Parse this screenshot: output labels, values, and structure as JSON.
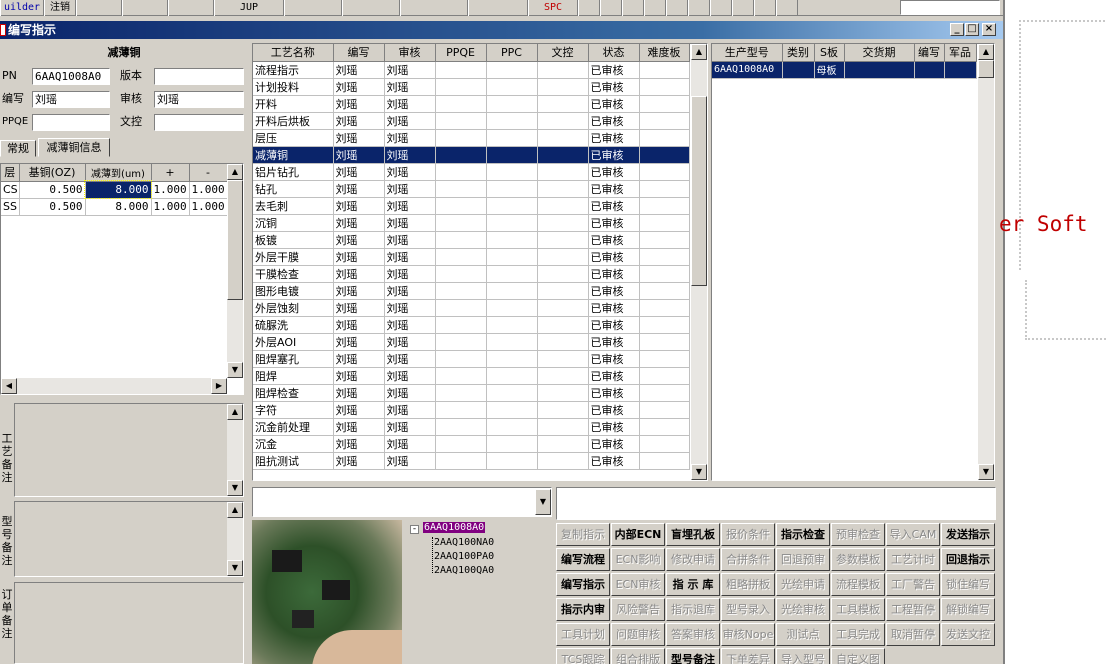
{
  "toolbar": {
    "items": [
      "uilder",
      "注销",
      "",
      "",
      "",
      "JUP",
      "",
      "",
      "",
      "",
      "SPC",
      "",
      "",
      "",
      "",
      "",
      "",
      "",
      "",
      "",
      ""
    ]
  },
  "window": {
    "title": "编写指示",
    "min": "_",
    "max": "□",
    "close": "×"
  },
  "left_panel": {
    "header": "减薄铜",
    "pn_label": "PN",
    "pn_value": "6AAQ1008A0",
    "version_label": "版本",
    "version_value": "",
    "writer_label": "编写",
    "writer_value": "刘瑶",
    "reviewer_label": "审核",
    "reviewer_value": "刘瑶",
    "ppqe_label": "PPQE",
    "ppqe_value": "",
    "doc_label": "文控",
    "doc_value": "",
    "tabs": [
      "常规",
      "减薄铜信息"
    ],
    "thin_table": {
      "headers": [
        "层",
        "基铜(OZ)",
        "减薄到(um)",
        "+",
        "-"
      ],
      "rows": [
        [
          "CS",
          "0.500",
          "8.000",
          "1.000",
          "1.000"
        ],
        [
          "SS",
          "0.500",
          "8.000",
          "1.000",
          "1.000"
        ]
      ]
    },
    "remarks": [
      {
        "label": "工艺备注"
      },
      {
        "label": "型号备注"
      },
      {
        "label": "订单备注"
      }
    ]
  },
  "process_table": {
    "headers": [
      "工艺名称",
      "编写",
      "审核",
      "PPQE",
      "PPC",
      "文控",
      "状态",
      "难度板"
    ],
    "rows": [
      [
        "流程指示",
        "刘瑶",
        "刘瑶",
        "",
        "",
        "",
        "已审核",
        ""
      ],
      [
        "计划投料",
        "刘瑶",
        "刘瑶",
        "",
        "",
        "",
        "已审核",
        ""
      ],
      [
        "开料",
        "刘瑶",
        "刘瑶",
        "",
        "",
        "",
        "已审核",
        ""
      ],
      [
        "开料后烘板",
        "刘瑶",
        "刘瑶",
        "",
        "",
        "",
        "已审核",
        ""
      ],
      [
        "层压",
        "刘瑶",
        "刘瑶",
        "",
        "",
        "",
        "已审核",
        ""
      ],
      [
        "减薄铜",
        "刘瑶",
        "刘瑶",
        "",
        "",
        "",
        "已审核",
        ""
      ],
      [
        "铝片钻孔",
        "刘瑶",
        "刘瑶",
        "",
        "",
        "",
        "已审核",
        ""
      ],
      [
        "钻孔",
        "刘瑶",
        "刘瑶",
        "",
        "",
        "",
        "已审核",
        ""
      ],
      [
        "去毛刺",
        "刘瑶",
        "刘瑶",
        "",
        "",
        "",
        "已审核",
        ""
      ],
      [
        "沉铜",
        "刘瑶",
        "刘瑶",
        "",
        "",
        "",
        "已审核",
        ""
      ],
      [
        "板镀",
        "刘瑶",
        "刘瑶",
        "",
        "",
        "",
        "已审核",
        ""
      ],
      [
        "外层干膜",
        "刘瑶",
        "刘瑶",
        "",
        "",
        "",
        "已审核",
        ""
      ],
      [
        "干膜检查",
        "刘瑶",
        "刘瑶",
        "",
        "",
        "",
        "已审核",
        ""
      ],
      [
        "图形电镀",
        "刘瑶",
        "刘瑶",
        "",
        "",
        "",
        "已审核",
        ""
      ],
      [
        "外层蚀刻",
        "刘瑶",
        "刘瑶",
        "",
        "",
        "",
        "已审核",
        ""
      ],
      [
        "硫脲洗",
        "刘瑶",
        "刘瑶",
        "",
        "",
        "",
        "已审核",
        ""
      ],
      [
        "外层AOI",
        "刘瑶",
        "刘瑶",
        "",
        "",
        "",
        "已审核",
        ""
      ],
      [
        "阻焊塞孔",
        "刘瑶",
        "刘瑶",
        "",
        "",
        "",
        "已审核",
        ""
      ],
      [
        "阻焊",
        "刘瑶",
        "刘瑶",
        "",
        "",
        "",
        "已审核",
        ""
      ],
      [
        "阻焊检查",
        "刘瑶",
        "刘瑶",
        "",
        "",
        "",
        "已审核",
        ""
      ],
      [
        "字符",
        "刘瑶",
        "刘瑶",
        "",
        "",
        "",
        "已审核",
        ""
      ],
      [
        "沉金前处理",
        "刘瑶",
        "刘瑶",
        "",
        "",
        "",
        "已审核",
        ""
      ],
      [
        "沉金",
        "刘瑶",
        "刘瑶",
        "",
        "",
        "",
        "已审核",
        ""
      ],
      [
        "阻抗测试",
        "刘瑶",
        "刘瑶",
        "",
        "",
        "",
        "已审核",
        ""
      ]
    ],
    "selected_row": 5
  },
  "model_table": {
    "headers": [
      "生产型号",
      "类别",
      "S板",
      "交货期",
      "编写",
      "军品"
    ],
    "rows": [
      [
        "6AAQ1008A0",
        "",
        "母板",
        "",
        "",
        ""
      ]
    ]
  },
  "tree": {
    "root": "6AAQ1008A0",
    "children": [
      "2AAQ100NA0",
      "2AAQ100PA0",
      "2AAQ100QA0"
    ]
  },
  "buttons": [
    [
      "复制指示",
      "内部ECN",
      "盲埋孔板",
      "报价条件",
      "指示检查",
      "预审检查",
      "导入CAM",
      "发送指示"
    ],
    [
      "编写流程",
      "ECN影响",
      "修改申请",
      "合拼条件",
      "回退预审",
      "参数模板",
      "工艺计时",
      "回退指示"
    ],
    [
      "编写指示",
      "ECN审核",
      "指 示 库",
      "粗略拼板",
      "光绘申请",
      "流程模板",
      "工厂警告",
      "锁住编写"
    ],
    [
      "指示内审",
      "风险警告",
      "指示退库",
      "型号录入",
      "光绘审核",
      "工具模板",
      "工程暂停",
      "解锁编写"
    ],
    [
      "工具计划",
      "问题审核",
      "答案审核",
      "审核Nope",
      "测试点",
      "工具完成",
      "取消暂停",
      "发送文控"
    ],
    [
      "TCS跟踪",
      "组合排版",
      "型号备注",
      "下单差异",
      "导入型号",
      "自定义图",
      "",
      ""
    ]
  ],
  "button_enabled": [
    [
      false,
      true,
      true,
      false,
      true,
      false,
      false,
      true
    ],
    [
      true,
      false,
      false,
      false,
      false,
      false,
      false,
      true
    ],
    [
      true,
      false,
      true,
      false,
      false,
      false,
      false,
      false
    ],
    [
      true,
      false,
      false,
      false,
      false,
      false,
      false,
      false
    ],
    [
      false,
      false,
      false,
      false,
      false,
      false,
      false,
      false
    ],
    [
      false,
      false,
      true,
      false,
      false,
      false,
      false,
      false
    ]
  ],
  "side_text": "er Soft"
}
